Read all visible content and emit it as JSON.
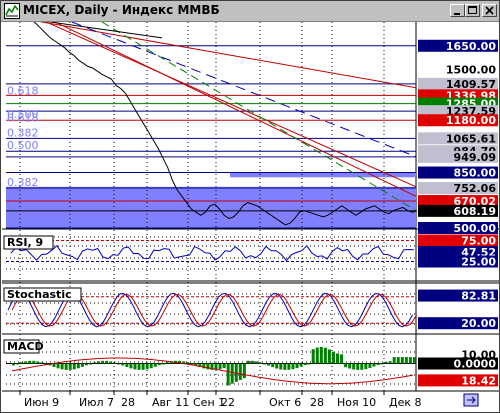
{
  "window": {
    "title": "MICEX, Daily - Индекс ММВБ"
  },
  "chart_data": [
    {
      "type": "line",
      "name": "price",
      "title": "MICEX, Daily - Индекс ММВБ",
      "ylim": [
        500,
        1800
      ],
      "price_labels": [
        {
          "value": 1650.0,
          "text": "1650.00",
          "style": "blue"
        },
        {
          "value": 1500.0,
          "text": "1500.00",
          "style": "plain"
        },
        {
          "value": 1409.57,
          "text": "1409.57",
          "style": "gray"
        },
        {
          "value": 1336.98,
          "text": "1336.98",
          "style": "red"
        },
        {
          "value": 1285.0,
          "text": "1285.00",
          "style": "green"
        },
        {
          "value": 1237.59,
          "text": "1237.59",
          "style": "gray"
        },
        {
          "value": 1180.0,
          "text": "1180.00",
          "style": "red"
        },
        {
          "value": 1065.61,
          "text": "1065.61",
          "style": "gray"
        },
        {
          "value": 984.7,
          "text": "984.70",
          "style": "gray"
        },
        {
          "value": 949.09,
          "text": "949.09",
          "style": "gray"
        },
        {
          "value": 850.0,
          "text": "850.00",
          "style": "blue"
        },
        {
          "value": 752.06,
          "text": "752.06",
          "style": "gray"
        },
        {
          "value": 670.02,
          "text": "670.02",
          "style": "red"
        },
        {
          "value": 608.19,
          "text": "608.19",
          "style": "black"
        },
        {
          "value": 500.0,
          "text": "500.00",
          "style": "blue"
        }
      ],
      "fib_labels": [
        {
          "value": 1330,
          "text": "0.618"
        },
        {
          "value": 1180,
          "text": "0.500"
        },
        {
          "value": 1160,
          "text": "0.618"
        },
        {
          "value": 1065,
          "text": "0.382"
        },
        {
          "value": 985,
          "text": "0.500"
        },
        {
          "value": 752,
          "text": "0.382"
        }
      ],
      "series": [
        {
          "name": "price",
          "values": [
            1840,
            1830,
            1815,
            1790,
            1760,
            1730,
            1700,
            1680,
            1660,
            1640,
            1610,
            1590,
            1560,
            1540,
            1520,
            1510,
            1490,
            1470,
            1455,
            1440,
            1400,
            1380,
            1350,
            1300,
            1250,
            1200,
            1150,
            1100,
            1050,
            1000,
            940,
            880,
            800,
            740,
            700,
            660,
            620,
            600,
            580,
            600,
            640,
            650,
            620,
            580,
            560,
            570,
            600,
            640,
            660,
            650,
            640,
            620,
            600,
            580,
            560,
            540,
            520,
            530,
            560,
            600,
            610,
            600,
            590,
            580,
            570,
            580,
            600,
            620,
            640,
            620,
            600,
            580,
            600,
            620,
            630,
            640,
            620,
            600,
            590,
            610,
            620,
            630,
            610,
            600,
            608
          ]
        }
      ],
      "x_labels": [
        "Июн 9",
        "Июл 7",
        "28",
        "Авг 11",
        "Сен 1",
        "22",
        "Окт 6",
        "28",
        "Ноя 10",
        "Дек 8"
      ]
    },
    {
      "type": "line",
      "name": "RSI",
      "title": "RSI, 9",
      "ylim": [
        0,
        100
      ],
      "price_labels": [
        {
          "value": 75.0,
          "text": "75.00",
          "style": "red"
        },
        {
          "value": 47.52,
          "text": "47.52",
          "style": "blue"
        },
        {
          "value": 25.0,
          "text": "25.00",
          "style": "blue"
        }
      ]
    },
    {
      "type": "line",
      "name": "Stochastic",
      "title": "Stochastic",
      "ylim": [
        0,
        100
      ],
      "price_labels": [
        {
          "value": 82.81,
          "text": "82.81",
          "style": "blue"
        },
        {
          "value": 20.0,
          "text": "20.00",
          "style": "blue"
        }
      ]
    },
    {
      "type": "bar",
      "name": "MACD",
      "title": "MACD",
      "price_labels": [
        {
          "value": 10.0,
          "text": "10.00",
          "style": "plain"
        },
        {
          "value": 0.0,
          "text": "0.0000",
          "style": "black"
        },
        {
          "value": -18.42,
          "text": "18.42",
          "style": "red"
        }
      ]
    }
  ]
}
